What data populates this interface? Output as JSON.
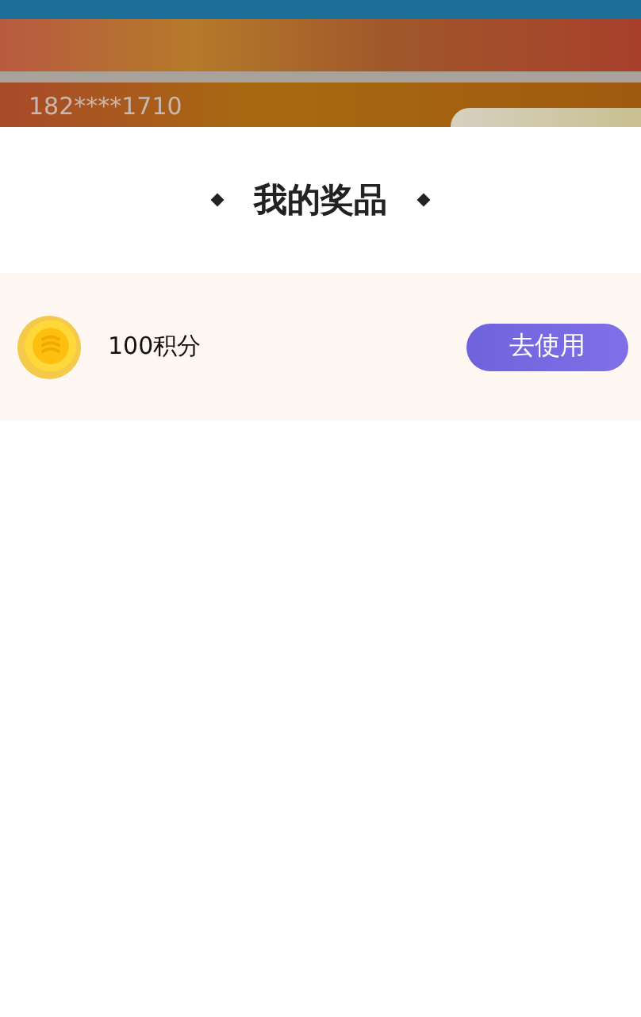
{
  "background": {
    "phone": "182****1710"
  },
  "sheet": {
    "title": "我的奖品",
    "prizes": [
      {
        "kind": "coin",
        "name": "100积分",
        "action": "去使用"
      }
    ]
  }
}
